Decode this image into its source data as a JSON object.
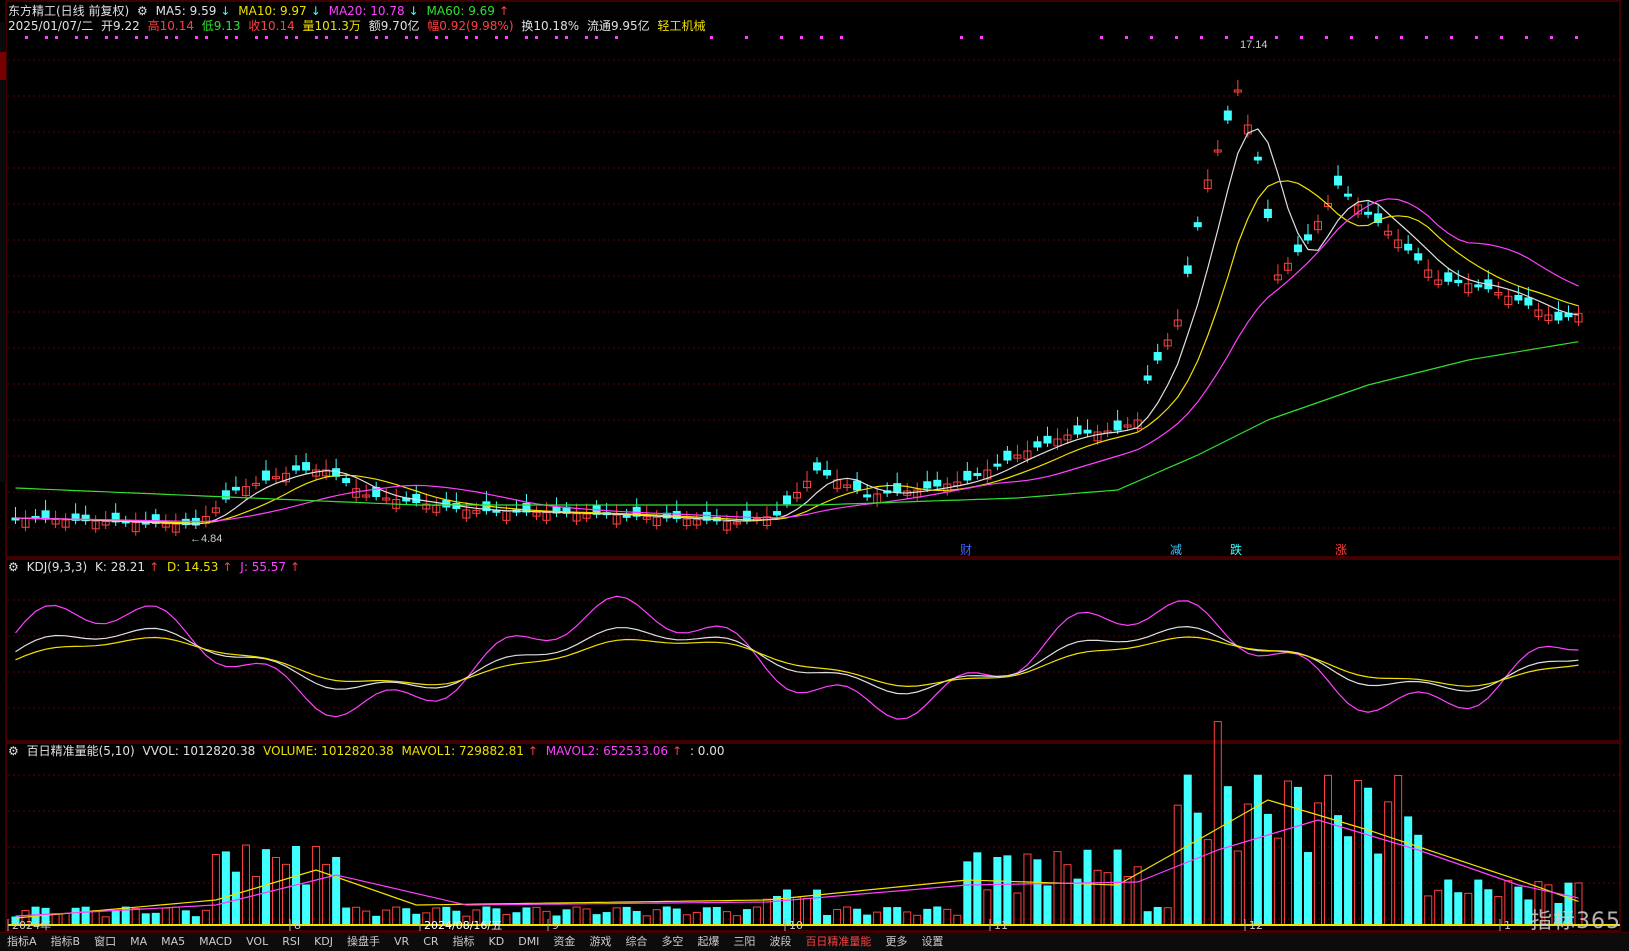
{
  "title": "东方精工(日线 前复权)",
  "indicators": {
    "ma5": "MA5: 9.59",
    "ma10": "MA10: 9.97",
    "ma20": "MA20: 10.78",
    "ma60": "MA60: 9.69"
  },
  "quote": {
    "date": "2025/01/07/二",
    "open": "开9.22",
    "high": "高10.14",
    "low": "低9.13",
    "close": "收10.14",
    "volume": "量101.3万",
    "amount": "额9.70亿",
    "change": "幅0.92(9.98%)",
    "turnover": "换10.18%",
    "float": "流通9.95亿",
    "industry": "轻工机械"
  },
  "price_annotations": {
    "high": "17.14",
    "low": "4.84"
  },
  "event_markers": [
    "财",
    "减",
    "跌",
    "涨"
  ],
  "kdj": {
    "name": "KDJ(9,3,3)",
    "k": "K: 28.21",
    "d": "D: 14.53",
    "j": "J: 55.57"
  },
  "volume_panel": {
    "name": "百日精准量能(5,10)",
    "vvol": "VVOL: 1012820.38",
    "volume": "VOLUME: 1012820.38",
    "mavol1": "MAVOL1: 729882.81",
    "mavol2": "MAVOL2: 652533.06",
    "extra": ": 0.00"
  },
  "time_axis": [
    "2024年",
    "8",
    "2024/08/16/五",
    "9",
    "10",
    "11",
    "12",
    "1"
  ],
  "bottom_tabs": [
    "指标A",
    "指标B",
    "窗口",
    "MA",
    "MA5",
    "MACD",
    "VOL",
    "RSI",
    "KDJ",
    "操盘手",
    "VR",
    "CR",
    "指标",
    "KD",
    "DMI",
    "资金",
    "游戏",
    "综合",
    "多空",
    "起爆",
    "三阳",
    "波段",
    "百日精准量能",
    "更多",
    "设置"
  ],
  "watermark": "指标365",
  "colors": {
    "up": "#ff4040",
    "down": "#40ffff",
    "ma5": "#e0e0e0",
    "ma10": "#f0e000",
    "ma20": "#ff40ff",
    "ma60": "#30e030"
  }
}
